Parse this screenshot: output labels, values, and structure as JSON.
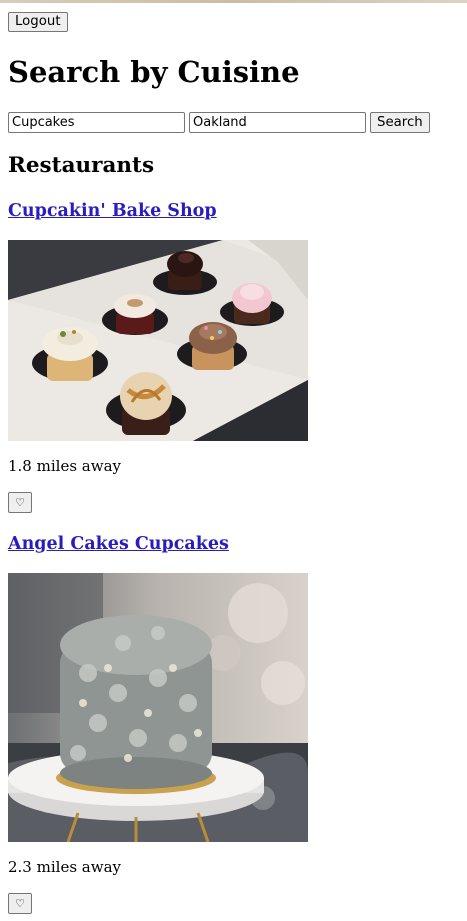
{
  "header": {
    "logout_label": "Logout"
  },
  "page_title": "Search by Cuisine",
  "search": {
    "cuisine_value": "Cupcakes",
    "location_value": "Oakland",
    "button_label": "Search"
  },
  "results": {
    "heading": "Restaurants",
    "items": [
      {
        "name": "Cupcakin' Bake Shop",
        "distance": "1.8 miles away",
        "favorite_icon": "♡"
      },
      {
        "name": "Angel Cakes Cupcakes",
        "distance": "2.3 miles away",
        "favorite_icon": "♡"
      }
    ]
  }
}
